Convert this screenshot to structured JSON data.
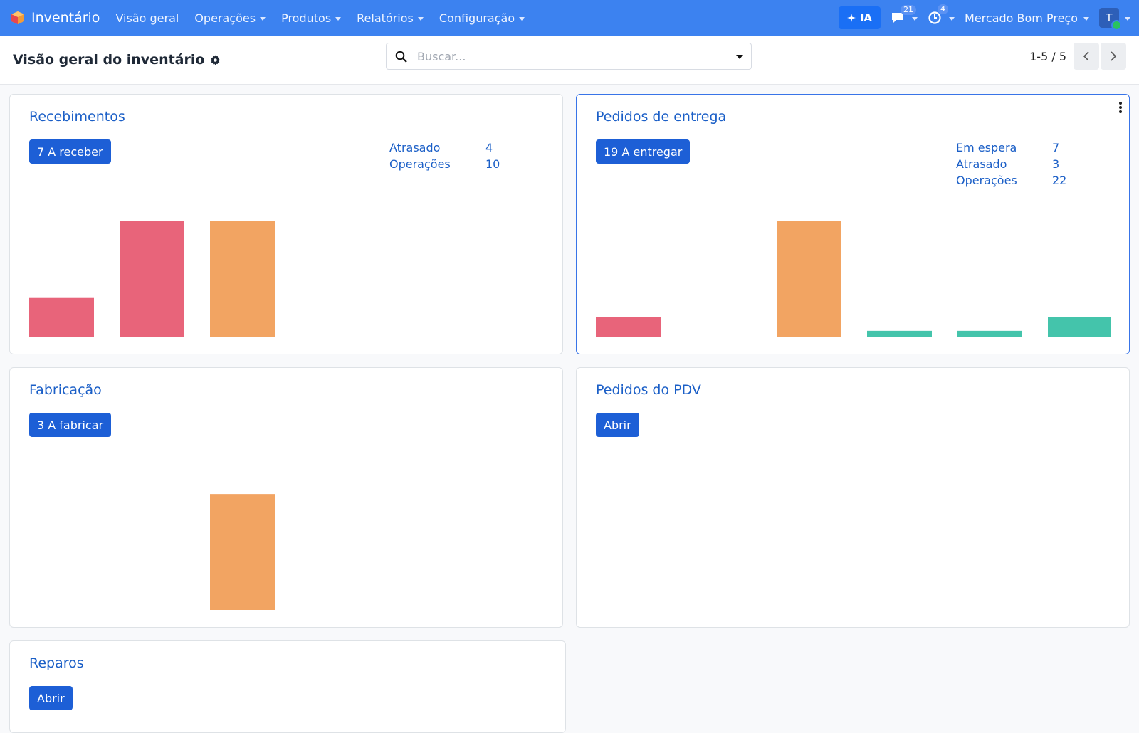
{
  "navbar": {
    "app_name": "Inventário",
    "menu": [
      {
        "label": "Visão geral",
        "dropdown": false
      },
      {
        "label": "Operações",
        "dropdown": true
      },
      {
        "label": "Produtos",
        "dropdown": true
      },
      {
        "label": "Relatórios",
        "dropdown": true
      },
      {
        "label": "Configuração",
        "dropdown": true
      }
    ],
    "ai_label": "IA",
    "messages_count": "21",
    "activities_count": "4",
    "company": "Mercado Bom Preço",
    "avatar_initial": "T"
  },
  "control": {
    "title": "Visão geral do inventário",
    "search_placeholder": "Buscar...",
    "pager": "1-5 / 5"
  },
  "colors": {
    "navbar": "#3c82f0",
    "late": "#e8647a",
    "today": "#f2a462",
    "future": "#44c4ab",
    "button": "#1d5fd6",
    "title": "#1b5fc7"
  },
  "cards": {
    "receipts": {
      "title": "Recebimentos",
      "button": "7 A receber",
      "stats": [
        {
          "label": "Atrasado",
          "value": "4"
        },
        {
          "label": "Operações",
          "value": "10"
        }
      ]
    },
    "deliveries": {
      "title": "Pedidos de entrega",
      "button": "19 A entregar",
      "stats": [
        {
          "label": "Em espera",
          "value": "7"
        },
        {
          "label": "Atrasado",
          "value": "3"
        },
        {
          "label": "Operações",
          "value": "22"
        }
      ]
    },
    "manufacturing": {
      "title": "Fabricação",
      "button": "3 A fabricar"
    },
    "pos": {
      "title": "Pedidos do PDV",
      "button": "Abrir"
    },
    "repairs": {
      "title": "Reparos",
      "button": "Abrir"
    }
  },
  "chart_data": [
    {
      "type": "bar",
      "name": "receipts",
      "values": [
        2,
        6,
        6,
        0,
        0,
        0
      ],
      "colors": [
        "late",
        "late",
        "today",
        "future",
        "future",
        "future"
      ],
      "ylim": [
        0,
        7
      ]
    },
    {
      "type": "bar",
      "name": "deliveries",
      "values": [
        1,
        0,
        6,
        0.3,
        0.3,
        1
      ],
      "colors": [
        "late",
        "late",
        "today",
        "future",
        "future",
        "future"
      ],
      "ylim": [
        0,
        7
      ]
    },
    {
      "type": "bar",
      "name": "manufacturing",
      "values": [
        0,
        0,
        6,
        0,
        0,
        0
      ],
      "colors": [
        "late",
        "late",
        "today",
        "future",
        "future",
        "future"
      ],
      "ylim": [
        0,
        7
      ]
    }
  ]
}
